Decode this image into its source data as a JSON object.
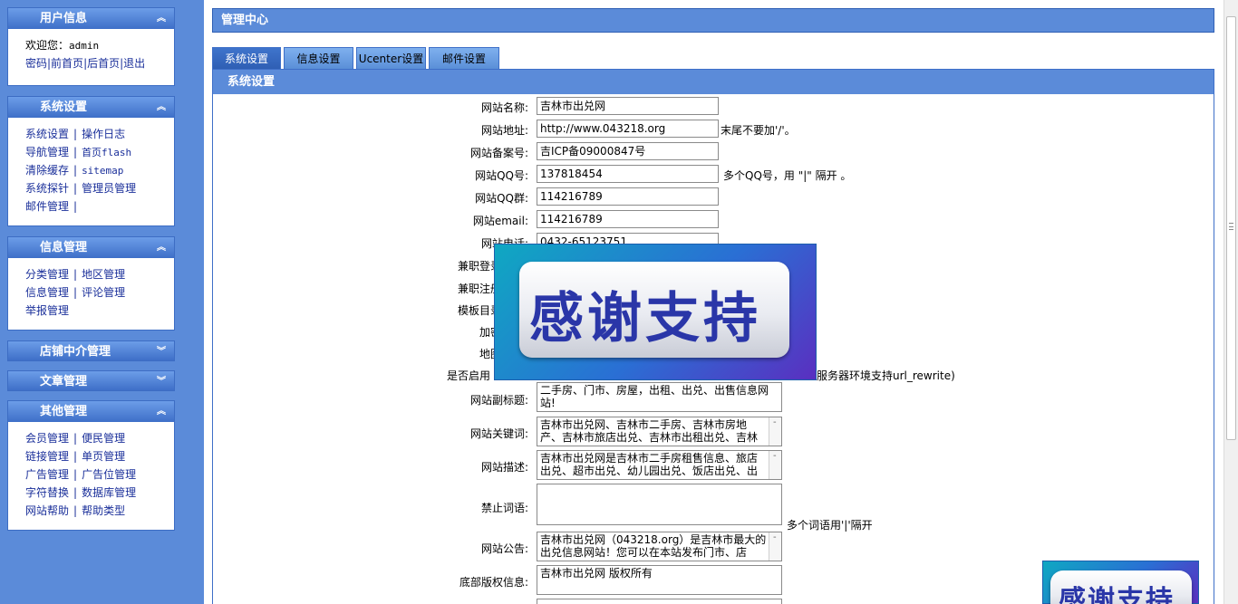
{
  "sidebar": {
    "user_panel": {
      "title": "用户信息",
      "welcome": "欢迎您：",
      "username": "admin",
      "links": [
        "密码",
        "|前首页",
        "|后首页",
        "|退出"
      ]
    },
    "system_panel": {
      "title": "系统设置",
      "rows": [
        [
          "系统设置",
          "操作日志"
        ],
        [
          "导航管理",
          "首页flash"
        ],
        [
          "清除缓存",
          "sitemap"
        ],
        [
          "系统探针",
          "管理员管理"
        ],
        [
          "邮件管理",
          ""
        ]
      ]
    },
    "info_panel": {
      "title": "信息管理",
      "rows": [
        [
          "分类管理",
          "地区管理"
        ],
        [
          "信息管理",
          "评论管理"
        ],
        [
          "举报管理"
        ]
      ]
    },
    "shop_panel": {
      "title": "店铺中介管理"
    },
    "article_panel": {
      "title": "文章管理"
    },
    "other_panel": {
      "title": "其他管理",
      "rows": [
        [
          "会员管理",
          "便民管理"
        ],
        [
          "链接管理",
          "单页管理"
        ],
        [
          "广告管理",
          "广告位管理"
        ],
        [
          "字符替换",
          "数据库管理"
        ],
        [
          "网站帮助",
          "帮助类型"
        ]
      ]
    },
    "expand_icon": "double-chevron-up",
    "collapse_icon": "double-chevron-down"
  },
  "main": {
    "title": "管理中心",
    "tabs": [
      "系统设置",
      "信息设置",
      "Ucenter设置",
      "邮件设置"
    ],
    "section_title": "系统设置",
    "fields": {
      "site_name": {
        "label": "网站名称:",
        "value": "吉林市出兑网"
      },
      "site_url": {
        "label": "网站地址:",
        "value": "http://www.043218.org",
        "hint": "末尾不要加'/'。"
      },
      "icp": {
        "label": "网站备案号:",
        "value": "吉ICP备09000847号"
      },
      "qq": {
        "label": "网站QQ号:",
        "value": "137818454",
        "hint": "多个QQ号，用 \"|\" 隔开 。"
      },
      "qq_group": {
        "label": "网站QQ群:",
        "value": "114216789"
      },
      "email": {
        "label": "网站email:",
        "value": "114216789"
      },
      "phone": {
        "label": "网站电话:",
        "value": "0432-65123751"
      },
      "pt_login": {
        "label": "兼职登录"
      },
      "pt_register": {
        "label": "兼职注册"
      },
      "template_dir": {
        "label": "模板目录"
      },
      "encrypt": {
        "label": "加密"
      },
      "map": {
        "label": "地图"
      },
      "rewrite": {
        "label": "是否启用",
        "hint": "服务器环境支持url_rewrite)"
      },
      "subtitle": {
        "label": "网站副标题:",
        "value": "二手房、门市、房屋，出租、出兑、出售信息网站!"
      },
      "keywords": {
        "label": "网站关键词:",
        "value": "吉林市出兑网、吉林市二手房、吉林市房地产、吉林市旅店出兑、吉林市出租出兑、吉林"
      },
      "description": {
        "label": "网站描述:",
        "value": "吉林市出兑网是吉林市二手房租售信息、旅店出兑、超市出兑、幼儿园出兑、饭店出兑、出"
      },
      "banned_words": {
        "label": "禁止词语:",
        "value": "",
        "hint": "多个词语用'|'隔开"
      },
      "notice": {
        "label": "网站公告:",
        "value": "吉林市出兑网（043218.org）是吉林市最大的出兑信息网站！您可以在本站发布门市、店"
      },
      "copyright": {
        "label": "底部版权信息:",
        "value": "吉林市出兑网 版权所有"
      }
    }
  },
  "banner": {
    "text": "感谢支持"
  }
}
